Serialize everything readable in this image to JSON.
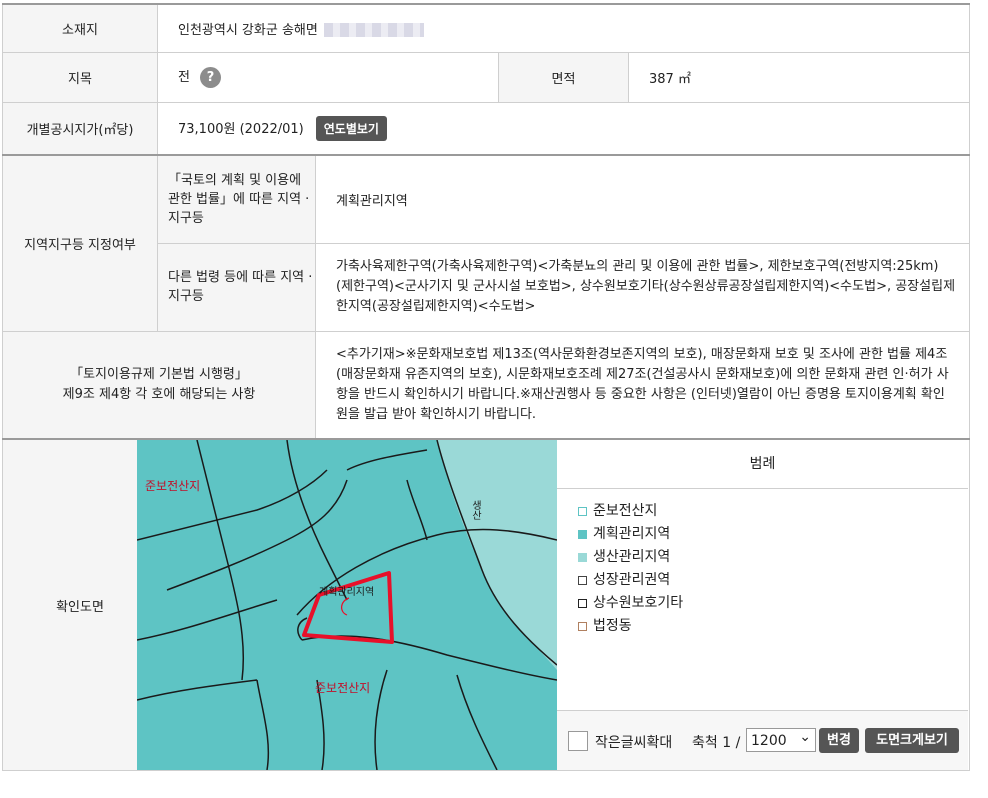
{
  "location": {
    "label": "소재지",
    "value": "인천광역시 강화군 송해면"
  },
  "land_category": {
    "label": "지목",
    "value": "전",
    "help": "?"
  },
  "area": {
    "label": "면적",
    "value": "387 ㎡"
  },
  "official_price": {
    "label": "개별공시지가(㎡당)",
    "value": "73,100원 (2022/01)",
    "button": "연도별보기"
  },
  "zoning": {
    "label": "지역지구등 지정여부",
    "national_label": "「국토의 계획 및 이용에 관한 법률」에 따른 지역 · 지구등",
    "national_value": "계획관리지역",
    "other_label": "다른 법령 등에 따른 지역 · 지구등",
    "other_value": "가축사육제한구역(가축사육제한구역)<가축분뇨의 관리 및 이용에 관한 법률>, 제한보호구역(전방지역:25km)(제한구역)<군사기지 및 군사시설 보호법>, 상수원보호기타(상수원상류공장설립제한지역)<수도법>, 공장설립제한지역(공장설립제한지역)<수도법>"
  },
  "enforcement": {
    "label_line1": "「토지이용규제 기본법 시행령」",
    "label_line2": "제9조 제4항 각 호에 해당되는 사항",
    "value": "<추가기재>※문화재보호법 제13조(역사문화환경보존지역의 보호), 매장문화재 보호 및 조사에 관한 법률 제4조(매장문화재 유존지역의 보호), 시문화재보호조례 제27조(건설공사시 문화재보호)에 의한 문화재 관련 인·허가 사항을 반드시 확인하시기 바랍니다.※재산권행사 등 중요한 사항은 (인터넷)열람이 아닌 증명용 토지이용계획 확인원을 발급 받아 확인하시기 바랍니다."
  },
  "map": {
    "label": "확인도면",
    "labels": [
      "준보전산지",
      "계획관리지역",
      "준보전산지",
      "생산"
    ],
    "colors": {
      "management": "#5ec4c4",
      "production": "#9ad9d7",
      "parcel": "#e8102a",
      "line": "#1a1a1a",
      "text": "#c0102a"
    }
  },
  "legend": {
    "title": "범례",
    "items": [
      {
        "name": "준보전산지",
        "fill": "#ffffff",
        "border": "#5ec4c4"
      },
      {
        "name": "계획관리지역",
        "fill": "#5ec4c4",
        "border": "#5ec4c4"
      },
      {
        "name": "생산관리지역",
        "fill": "#9ad9d7",
        "border": "#9ad9d7"
      },
      {
        "name": "성장관리권역",
        "fill": "#ffffff",
        "border": "#444444"
      },
      {
        "name": "상수원보호기타",
        "fill": "#ffffff",
        "border": "#222222"
      },
      {
        "name": "법정동",
        "fill": "#ffffff",
        "border": "#b08060"
      }
    ]
  },
  "controls": {
    "small_text_zoom": "작은글씨확대",
    "scale_label": "축척 1 /",
    "scale_value": "1200",
    "change_button": "변경",
    "enlarge_button": "도면크게보기"
  }
}
